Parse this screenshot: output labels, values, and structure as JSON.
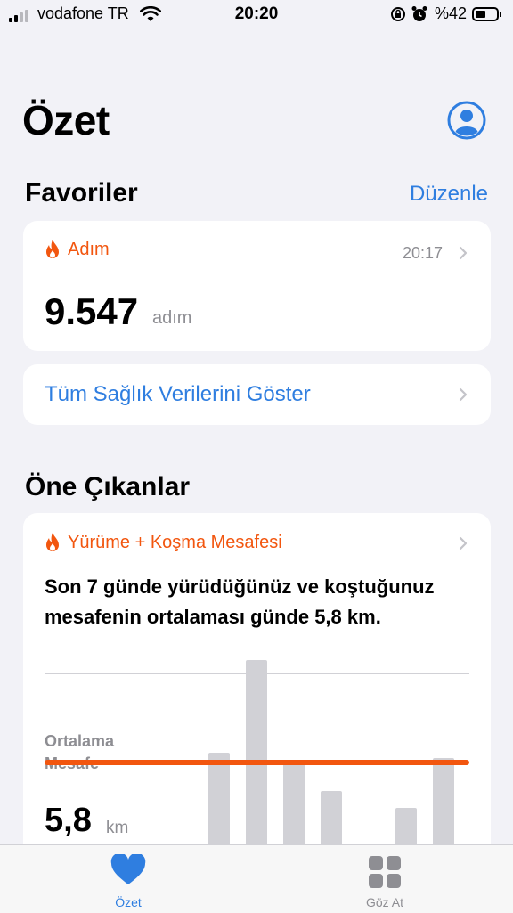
{
  "status_bar": {
    "carrier": "vodafone TR",
    "time": "20:20",
    "battery": "%42",
    "battery_level": 0.42
  },
  "header": {
    "title": "Özet"
  },
  "favorites": {
    "title": "Favoriler",
    "edit_label": "Düzenle",
    "steps_card": {
      "label": "Adım",
      "time": "20:17",
      "value": "9.547",
      "unit": "adım"
    },
    "show_all_label": "Tüm Sağlık Verilerini Göster"
  },
  "highlights": {
    "title": "Öne Çıkanlar",
    "card": {
      "label": "Yürüme + Koşma Mesafesi",
      "summary": "Son 7 günde yürüdüğünüz ve koştuğunuz mesafenin ortalaması günde 5,8 km.",
      "avg_label_line1": "Ortalama",
      "avg_label_line2": "Mesafe",
      "avg_value": "5,8",
      "avg_unit": "km"
    }
  },
  "chart_data": {
    "type": "bar",
    "title": "",
    "categories": [
      "",
      "",
      "",
      "",
      "",
      "",
      ""
    ],
    "series": [
      {
        "values": [
          6.5,
          13,
          5.8,
          3.8,
          0,
          2.6,
          6.1
        ]
      }
    ],
    "average": 5.8,
    "ylim": [
      0,
      14
    ]
  },
  "tab_bar": {
    "tabs": [
      {
        "label": "Özet",
        "icon": "heart-icon",
        "active": true
      },
      {
        "label": "Göz At",
        "icon": "grid-icon",
        "active": false
      }
    ]
  },
  "colors": {
    "accent_orange": "#f2560f",
    "link_blue": "#2f7ee0",
    "background": "#f2f2f7"
  }
}
